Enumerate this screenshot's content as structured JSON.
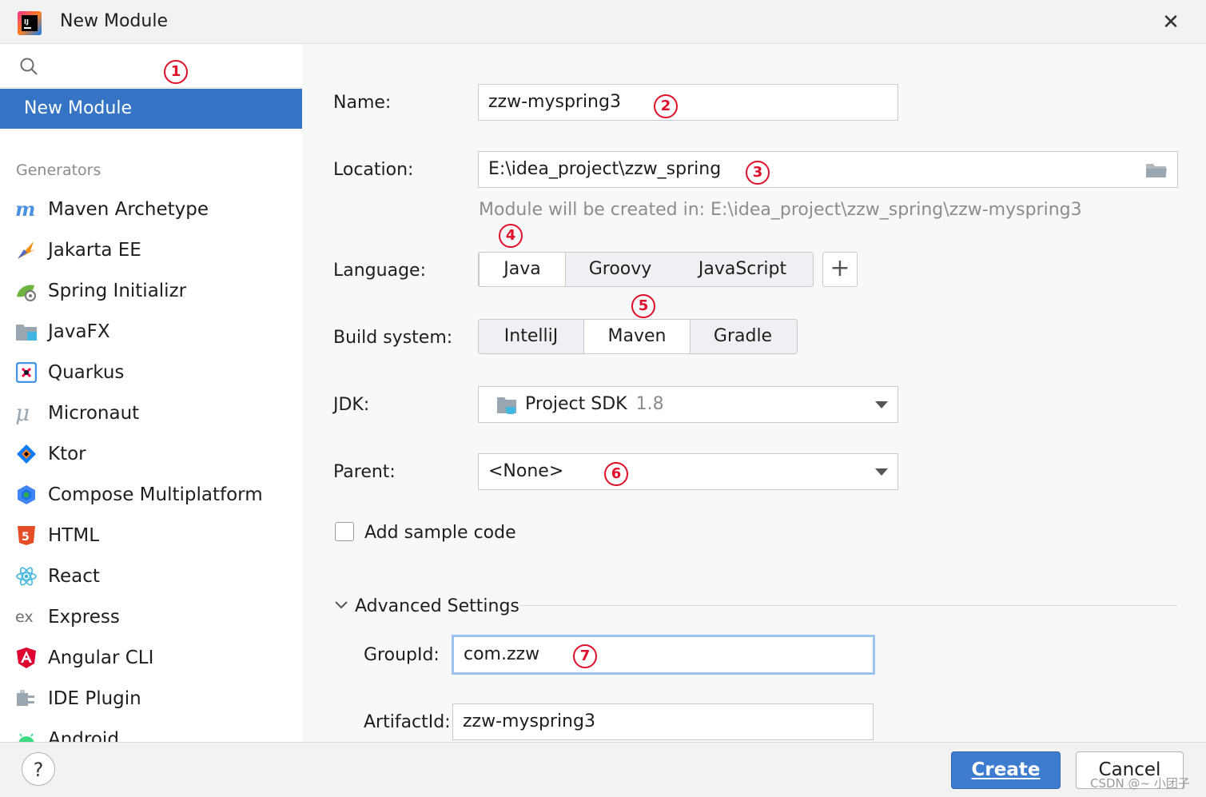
{
  "window": {
    "title": "New Module",
    "close_glyph": "✕"
  },
  "search": {
    "placeholder": ""
  },
  "sidebar": {
    "selected": "New Module",
    "group_label": "Generators",
    "items": [
      {
        "label": "Maven Archetype",
        "icon": "maven-icon"
      },
      {
        "label": "Jakarta EE",
        "icon": "jakarta-icon"
      },
      {
        "label": "Spring Initializr",
        "icon": "spring-icon"
      },
      {
        "label": "JavaFX",
        "icon": "javafx-icon"
      },
      {
        "label": "Quarkus",
        "icon": "quarkus-icon"
      },
      {
        "label": "Micronaut",
        "icon": "micronaut-icon"
      },
      {
        "label": "Ktor",
        "icon": "ktor-icon"
      },
      {
        "label": "Compose Multiplatform",
        "icon": "compose-icon"
      },
      {
        "label": "HTML",
        "icon": "html5-icon"
      },
      {
        "label": "React",
        "icon": "react-icon"
      },
      {
        "label": "Express",
        "icon": "express-icon"
      },
      {
        "label": "Angular CLI",
        "icon": "angular-icon"
      },
      {
        "label": "IDE Plugin",
        "icon": "plugin-icon"
      },
      {
        "label": "Android",
        "icon": "android-icon"
      }
    ]
  },
  "form": {
    "name_label": "Name:",
    "name_value": "zzw-myspring3",
    "location_label": "Location:",
    "location_value": "E:\\idea_project\\zzw_spring",
    "location_hint": "Module will be created in: E:\\idea_project\\zzw_spring\\zzw-myspring3",
    "language_label": "Language:",
    "languages": [
      "Java",
      "Groovy",
      "JavaScript"
    ],
    "language_selected": "Java",
    "add_language_glyph": "+",
    "build_label": "Build system:",
    "build_systems": [
      "IntelliJ",
      "Maven",
      "Gradle"
    ],
    "build_selected": "Maven",
    "jdk_label": "JDK:",
    "jdk_value": "Project SDK",
    "jdk_version": "1.8",
    "parent_label": "Parent:",
    "parent_value": "<None>",
    "sample_code_label": "Add sample code",
    "sample_code_checked": false,
    "advanced_label": "Advanced Settings",
    "groupid_label": "GroupId:",
    "groupid_value": "com.zzw",
    "artifactid_label": "ArtifactId:",
    "artifactid_value": "zzw-myspring3"
  },
  "annotations": [
    "1",
    "2",
    "3",
    "4",
    "5",
    "6",
    "7"
  ],
  "footer": {
    "help_glyph": "?",
    "create_label": "Create",
    "cancel_label": "Cancel",
    "watermark": "CSDN @~ 小团子"
  },
  "colors": {
    "accent": "#3573c4",
    "badge": "#e0102a",
    "create_button": "#3e7cd0"
  }
}
